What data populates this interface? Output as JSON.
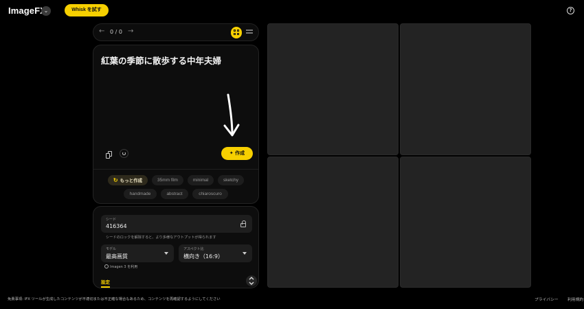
{
  "header": {
    "logo": "ImageFX",
    "logo_menu_glyph": "⌄",
    "whisk_button": "Whisk を試す",
    "help_glyph": "?"
  },
  "nav": {
    "prev_glyph": "←",
    "count": "0 / 0",
    "next_glyph": "→"
  },
  "prompt": {
    "text": "紅葉の季節に散歩する中年夫婦",
    "create_label": "✦ 作成"
  },
  "chips": {
    "more_label": "もっと作成",
    "more_glyph": "↻",
    "items": [
      "35mm film",
      "minimal",
      "sketchy",
      "handmade",
      "abstract",
      "chiaroscuro"
    ]
  },
  "settings": {
    "seed_label": "シード",
    "seed_value": "416364",
    "seed_hint": "シードのロックを解除すると、より多様なアウトプットが得られます",
    "model_label": "モデル",
    "model_value": "最高画質",
    "aspect_label": "アスペクト比",
    "aspect_value": "横向き（16:9）",
    "model_note": "Imagen 3 を利用",
    "tab_label": "設定",
    "collapse_glyph": "⌃⌄"
  },
  "footer": {
    "disclaimer": "免責事項: IFX ツールが生成したコンテンツが不適切または不正確な場合もあるため、コンテンツを再確認するようにしてください",
    "privacy": "プライバシー",
    "terms": "利用規約"
  },
  "colors": {
    "accent": "#f7d000",
    "background": "#000000",
    "tile": "#232323"
  },
  "icons": [
    "help-icon",
    "arrow-left-icon",
    "arrow-right-icon",
    "grid-view-icon",
    "list-view-icon",
    "copy-icon",
    "reset-icon",
    "sparkle-icon",
    "refresh-icon",
    "lock-open-icon",
    "caret-down-icon",
    "info-icon",
    "collapse-icon"
  ]
}
